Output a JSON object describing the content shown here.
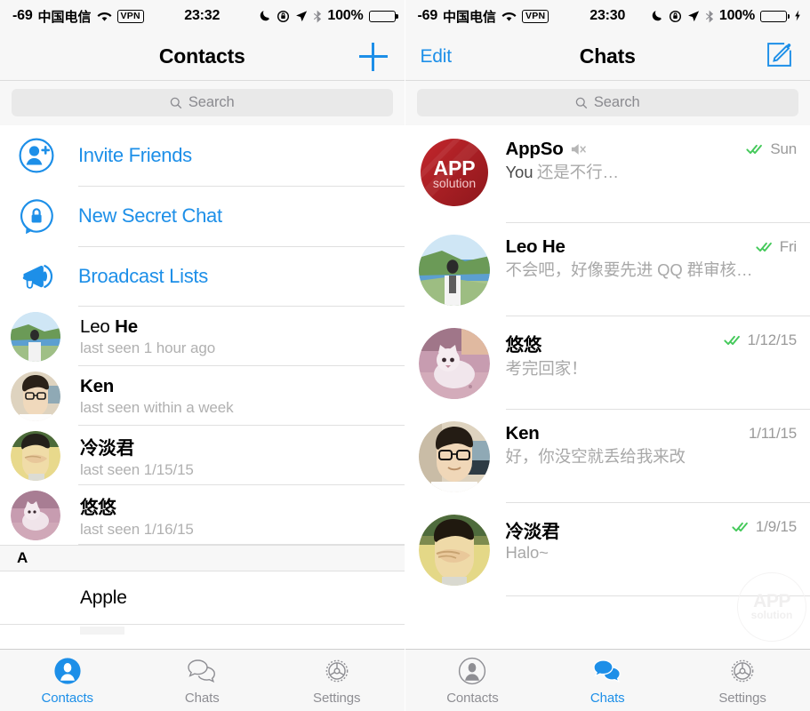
{
  "left": {
    "statusbar": {
      "signal": "-69",
      "carrier": "中国电信",
      "wifi_icon": "wifi-icon",
      "vpn": "VPN",
      "time": "23:32",
      "moon_icon": "moon-icon",
      "rotation_lock_icon": "rotation-lock-icon",
      "location_icon": "location-arrow-icon",
      "bluetooth_icon": "bluetooth-icon",
      "battery": "100%",
      "battery_state": "full"
    },
    "nav": {
      "title": "Contacts",
      "add_icon": "plus-icon"
    },
    "search": {
      "placeholder": "Search",
      "icon": "search-icon"
    },
    "actions": [
      {
        "label": "Invite Friends",
        "icon": "person-add-icon"
      },
      {
        "label": "New Secret Chat",
        "icon": "lock-bubble-icon"
      },
      {
        "label": "Broadcast Lists",
        "icon": "megaphone-icon"
      }
    ],
    "contacts": [
      {
        "first": "Leo ",
        "last": "He",
        "status": "last seen 1 hour ago",
        "avatar": "leo-avatar"
      },
      {
        "first": "",
        "last": "Ken",
        "status": "last seen within a week",
        "avatar": "ken-avatar"
      },
      {
        "first": "",
        "last": "冷淡君",
        "status": "last seen 1/15/15",
        "avatar": "lengdanjun-avatar"
      },
      {
        "first": "",
        "last": "悠悠",
        "status": "last seen 1/16/15",
        "avatar": "youyou-avatar"
      }
    ],
    "section_header": "A",
    "section_rows": [
      {
        "name": "Apple"
      }
    ],
    "tabs": [
      {
        "label": "Contacts",
        "icon": "person-filled-icon",
        "active": true
      },
      {
        "label": "Chats",
        "icon": "chat-bubbles-icon",
        "active": false
      },
      {
        "label": "Settings",
        "icon": "gear-icon",
        "active": false
      }
    ]
  },
  "right": {
    "statusbar": {
      "signal": "-69",
      "carrier": "中国电信",
      "wifi_icon": "wifi-icon",
      "vpn": "VPN",
      "time": "23:30",
      "moon_icon": "moon-icon",
      "rotation_lock_icon": "rotation-lock-icon",
      "location_icon": "location-arrow-icon",
      "bluetooth_icon": "bluetooth-icon",
      "battery": "100%",
      "battery_state": "charging",
      "bolt_icon": "lightning-bolt-icon"
    },
    "nav": {
      "edit_label": "Edit",
      "title": "Chats",
      "compose_icon": "compose-pencil-icon"
    },
    "search": {
      "placeholder": "Search",
      "icon": "search-icon"
    },
    "chats": [
      {
        "name": "AppSo",
        "muted": true,
        "sender": "You",
        "message": "还是不行…",
        "date": "Sun",
        "ticks": "double-check-read",
        "avatar": "appso-logo"
      },
      {
        "name": "Leo He",
        "muted": false,
        "sender": "",
        "message": "不会吧，好像要先进 QQ 群审核…",
        "date": "Fri",
        "ticks": "double-check-read",
        "avatar": "leo-avatar"
      },
      {
        "name": "悠悠",
        "muted": false,
        "sender": "",
        "message": "考完回家！",
        "date": "1/12/15",
        "ticks": "double-check-read",
        "avatar": "youyou-avatar"
      },
      {
        "name": "Ken",
        "muted": false,
        "sender": "",
        "message": "好，你没空就丢给我来改",
        "date": "1/11/15",
        "ticks": "none",
        "avatar": "ken-avatar"
      },
      {
        "name": "冷淡君",
        "muted": false,
        "sender": "",
        "message": "Halo~",
        "date": "1/9/15",
        "ticks": "double-check-read",
        "avatar": "lengdanjun-avatar"
      }
    ],
    "watermark": {
      "line1": "APP",
      "line2": "solution"
    },
    "tabs": [
      {
        "label": "Contacts",
        "icon": "person-outline-icon",
        "active": false
      },
      {
        "label": "Chats",
        "icon": "chat-bubbles-filled-icon",
        "active": true
      },
      {
        "label": "Settings",
        "icon": "gear-icon",
        "active": false
      }
    ]
  },
  "colors": {
    "accent": "#1d8fe8",
    "tick_green": "#44c95a",
    "bar_bg": "#f7f7f7",
    "muted_text": "#a8a8a8"
  },
  "appso_logo": {
    "line1": "APP",
    "line2": "solution"
  }
}
